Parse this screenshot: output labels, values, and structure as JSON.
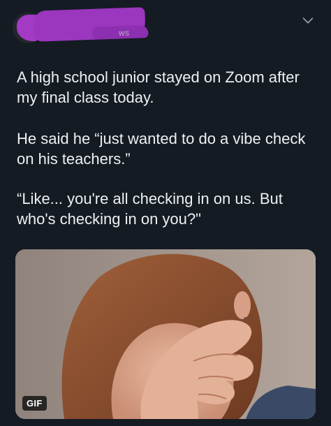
{
  "header": {
    "handle_tail": "ws",
    "menu_icon": "chevron-down-icon",
    "redaction_color": "#9b36bf"
  },
  "tweet": {
    "paragraphs": [
      "A high school junior stayed on Zoom after my final class today.",
      "He said he “just wanted to do a vibe check on his teachers.”",
      "“Like... you're all checking in on us. But who's checking in on you?\""
    ]
  },
  "media": {
    "badge": "GIF"
  },
  "colors": {
    "background": "#151b23",
    "text": "#edf0f3",
    "accent_redaction": "#9b36bf"
  }
}
